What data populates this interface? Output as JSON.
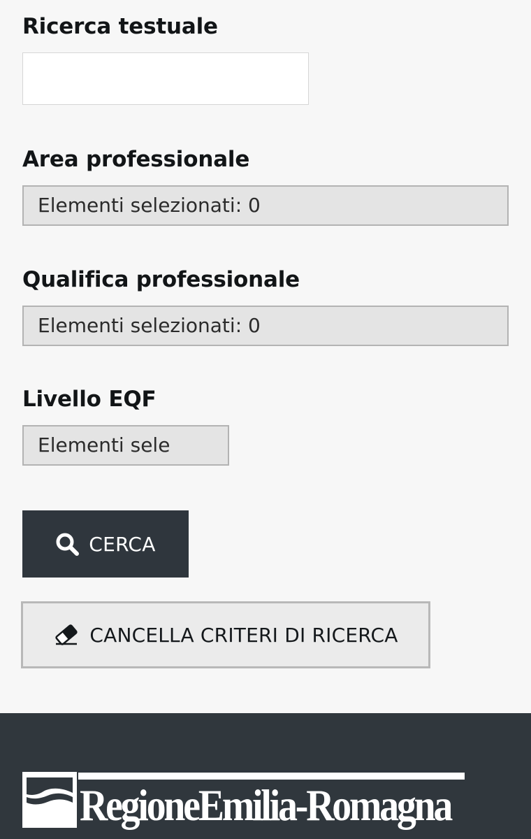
{
  "search": {
    "text_label": "Ricerca testuale",
    "text_value": "",
    "text_placeholder": ""
  },
  "filters": [
    {
      "label": "Area professionale",
      "value": "Elementi selezionati: 0"
    },
    {
      "label": "Qualifica professionale",
      "value": "Elementi selezionati: 0"
    },
    {
      "label": "Livello EQF",
      "value": "Elementi sele"
    }
  ],
  "buttons": {
    "search_label": "CERCA",
    "search_icon": "search-icon",
    "clear_label": "CANCELLA CRITERI DI RICERCA",
    "clear_icon": "eraser-icon"
  },
  "footer": {
    "logo_text": "RegioneEmilia-Romagna",
    "background_color": "#30373d"
  },
  "colors": {
    "primary_button": "#2f363d",
    "secondary_button": "#ebebeb",
    "select_background": "#e4e4e4"
  }
}
